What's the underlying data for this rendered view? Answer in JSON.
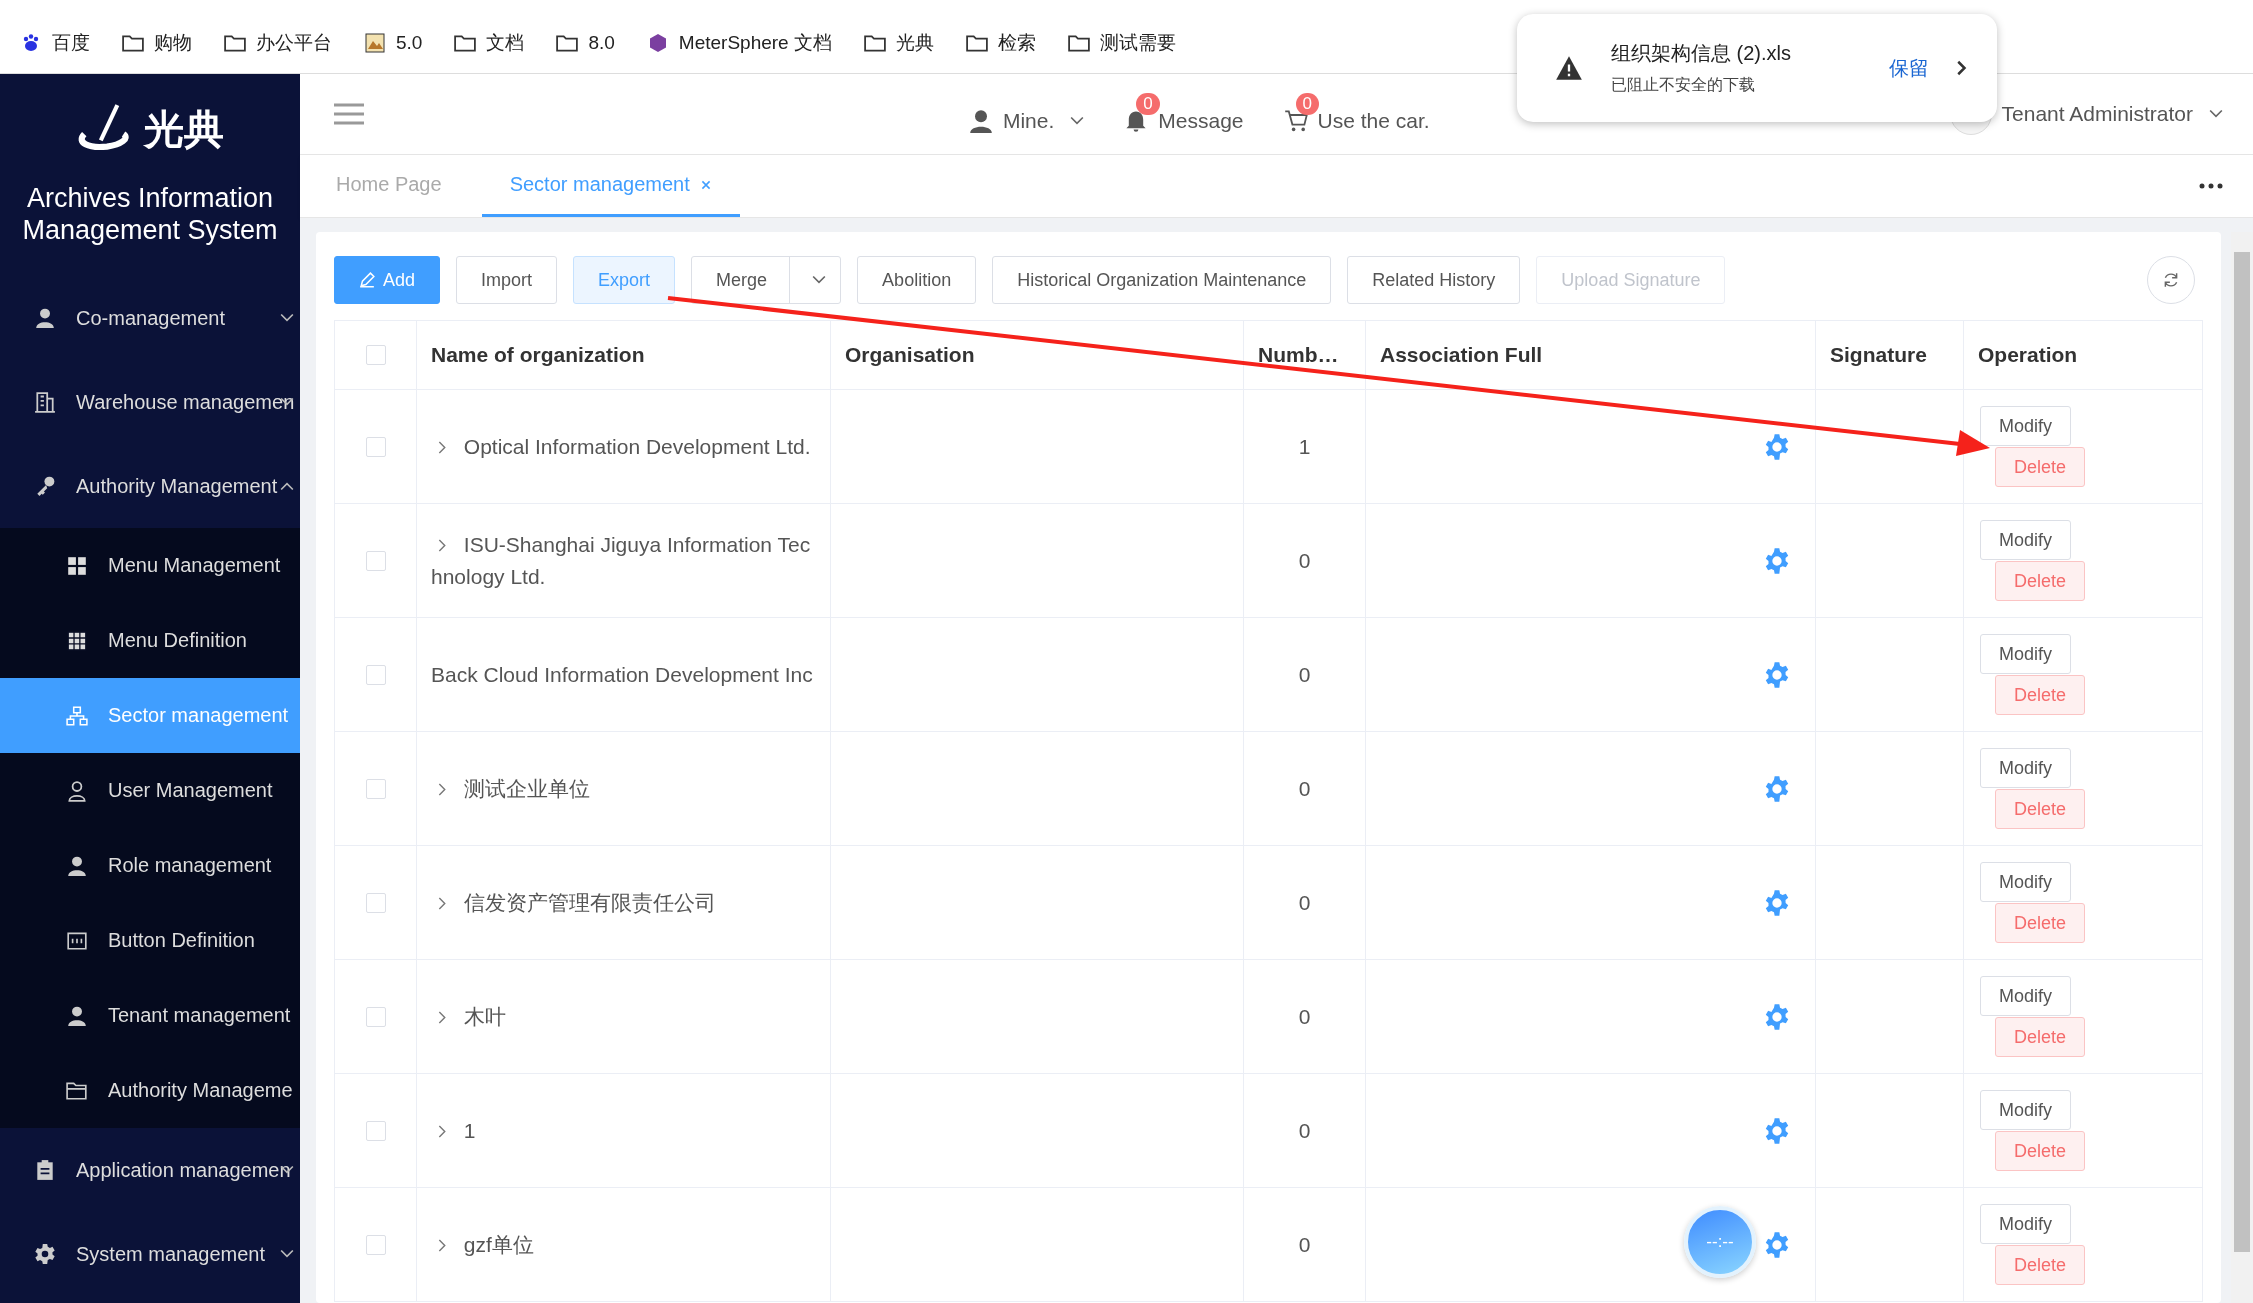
{
  "bookmarks": [
    {
      "label": "百度",
      "kind": "baidu"
    },
    {
      "label": "购物",
      "kind": "folder"
    },
    {
      "label": "办公平台",
      "kind": "folder"
    },
    {
      "label": "5.0",
      "kind": "image"
    },
    {
      "label": "文档",
      "kind": "folder"
    },
    {
      "label": "8.0",
      "kind": "folder"
    },
    {
      "label": "MeterSphere 文档",
      "kind": "cube"
    },
    {
      "label": "光典",
      "kind": "folder"
    },
    {
      "label": "检索",
      "kind": "folder"
    },
    {
      "label": "测试需要",
      "kind": "folder"
    }
  ],
  "download_popup": {
    "filename": "组织架构信息 (2).xls",
    "status": "已阻止不安全的下载",
    "action": "保留"
  },
  "sidebar": {
    "logo": "光典",
    "title": "Archives Information Management System",
    "items": [
      {
        "label": "Co-management",
        "expanded": false
      },
      {
        "label": "Warehouse managemen",
        "expanded": false
      },
      {
        "label": "Authority Management",
        "expanded": true,
        "children": [
          {
            "label": "Menu Management",
            "selected": false
          },
          {
            "label": "Menu Definition",
            "selected": false
          },
          {
            "label": "Sector management",
            "selected": true
          },
          {
            "label": "User Management",
            "selected": false
          },
          {
            "label": "Role management",
            "selected": false
          },
          {
            "label": "Button Definition",
            "selected": false
          },
          {
            "label": "Tenant management",
            "selected": false
          },
          {
            "label": "Authority Manageme",
            "selected": false
          }
        ]
      },
      {
        "label": "Application managemen",
        "expanded": false
      },
      {
        "label": "System management",
        "expanded": false
      }
    ]
  },
  "header": {
    "user": "Mine.",
    "message": {
      "label": "Message",
      "count": "0"
    },
    "cart": {
      "label": "Use the car.",
      "count": "0"
    },
    "tenant": "Tenant Administrator"
  },
  "tabs": [
    {
      "label": "Home Page",
      "selected": false
    },
    {
      "label": "Sector management",
      "selected": true
    }
  ],
  "toolbar": [
    {
      "label": "Add",
      "kind": "primary",
      "disabled": false
    },
    {
      "label": "Import",
      "kind": "default",
      "disabled": false
    },
    {
      "label": "Export",
      "kind": "active",
      "disabled": false
    },
    {
      "label": "Merge",
      "kind": "split",
      "disabled": false
    },
    {
      "label": "Abolition",
      "kind": "default",
      "disabled": false
    },
    {
      "label": "Historical Organization Maintenance",
      "kind": "default",
      "disabled": false
    },
    {
      "label": "Related History",
      "kind": "default",
      "disabled": false
    },
    {
      "label": "Upload Signature",
      "kind": "default",
      "disabled": true
    }
  ],
  "table": {
    "select_all": false,
    "columns": [
      "Name of organization",
      "Organisation",
      "Numb…",
      "Association Full",
      "Signature",
      "Operation"
    ],
    "rows": [
      {
        "name": "Optical Information Development Ltd.",
        "expandable": true,
        "number": "1",
        "checked": false,
        "modify": "Modify",
        "delete": "Delete"
      },
      {
        "name": "ISU-Shanghai Jiguya Information Technology Ltd.",
        "expandable": true,
        "number": "0",
        "checked": false,
        "modify": "Modify",
        "delete": "Delete"
      },
      {
        "name": "Back Cloud Information Development Inc",
        "expandable": false,
        "number": "0",
        "checked": false,
        "modify": "Modify",
        "delete": "Delete"
      },
      {
        "name": "测试企业单位",
        "expandable": true,
        "number": "0",
        "checked": false,
        "modify": "Modify",
        "delete": "Delete"
      },
      {
        "name": "信发资产管理有限责任公司",
        "expandable": true,
        "number": "0",
        "checked": false,
        "modify": "Modify",
        "delete": "Delete"
      },
      {
        "name": "木叶",
        "expandable": true,
        "number": "0",
        "checked": false,
        "modify": "Modify",
        "delete": "Delete"
      },
      {
        "name": "1",
        "expandable": true,
        "number": "0",
        "checked": false,
        "modify": "Modify",
        "delete": "Delete"
      },
      {
        "name": "gzf单位",
        "expandable": true,
        "number": "0",
        "checked": false,
        "modify": "Modify",
        "delete": "Delete"
      }
    ]
  },
  "clock_widget": "--:--"
}
